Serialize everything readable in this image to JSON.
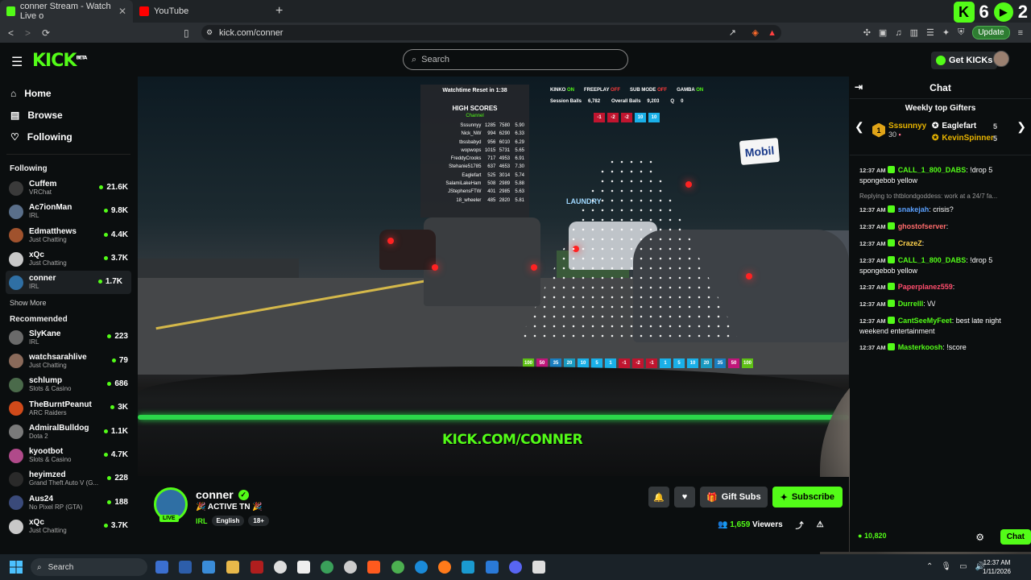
{
  "browser": {
    "tabs": [
      {
        "label": "conner Stream - Watch Live o",
        "active": true,
        "favicon_color": "#53fc18"
      },
      {
        "label": "YouTube",
        "active": false,
        "favicon_color": "#ff0000"
      }
    ],
    "new_tab_icon": "plus-icon",
    "top_right_score": {
      "kick": "6",
      "play": "2"
    },
    "url": "kick.com/conner",
    "update_label": "Update",
    "shield_badge": "1"
  },
  "header": {
    "logo": "KICK",
    "logo_sup": "BETA",
    "search_placeholder": "Search",
    "get_kicks_label": "Get KICKs"
  },
  "sidebar": {
    "nav": [
      {
        "label": "Home",
        "icon": "home-icon"
      },
      {
        "label": "Browse",
        "icon": "browse-icon"
      },
      {
        "label": "Following",
        "icon": "heart-icon"
      }
    ],
    "following_title": "Following",
    "following": [
      {
        "name": "Cuffem",
        "category": "VRChat",
        "viewers": "21.6K",
        "color": "#3a3a3a"
      },
      {
        "name": "Ac7ionMan",
        "category": "IRL",
        "viewers": "9.8K",
        "color": "#5a6f8a"
      },
      {
        "name": "Edmatthews",
        "category": "Just Chatting",
        "viewers": "4.4K",
        "color": "#a0522d"
      },
      {
        "name": "xQc",
        "category": "Just Chatting",
        "viewers": "3.7K",
        "color": "#c8c8c8"
      },
      {
        "name": "conner",
        "category": "IRL",
        "viewers": "1.7K",
        "color": "#2f6fa4"
      }
    ],
    "show_more": "Show More",
    "recommended_title": "Recommended",
    "recommended": [
      {
        "name": "SlyKane",
        "category": "IRL",
        "viewers": "223",
        "color": "#6a6a6a"
      },
      {
        "name": "watchsarahlive",
        "category": "Just Chatting",
        "viewers": "79",
        "color": "#8a6a5a"
      },
      {
        "name": "schlump",
        "category": "Slots & Casino",
        "viewers": "686",
        "color": "#4a6a4a"
      },
      {
        "name": "TheBurntPeanut",
        "category": "ARC Raiders",
        "viewers": "3K",
        "color": "#d04a1a"
      },
      {
        "name": "AdmiralBulldog",
        "category": "Dota 2",
        "viewers": "1.1K",
        "color": "#7a7a7a"
      },
      {
        "name": "kyootbot",
        "category": "Slots & Casino",
        "viewers": "4.7K",
        "color": "#b04a8a"
      },
      {
        "name": "heyimzed",
        "category": "Grand Theft Auto V (G...",
        "viewers": "228",
        "color": "#2a2a2a"
      },
      {
        "name": "Aus24",
        "category": "No Pixel RP (GTA)",
        "viewers": "188",
        "color": "#3a4a7a"
      },
      {
        "name": "xQc",
        "category": "Just Chatting",
        "viewers": "3.7K",
        "color": "#c8c8c8"
      }
    ]
  },
  "overlay": {
    "watchtime": "Watchtime Reset in 1:38",
    "high_scores_title": "HIGH SCORES",
    "high_scores_subtitle": "Channel",
    "high_scores": [
      [
        "Sssunnyy",
        "1285",
        "7580",
        "5.90"
      ],
      [
        "Nick_NW",
        "994",
        "6290",
        "6.33"
      ],
      [
        "tbssbabyd",
        "956",
        "6010",
        "6.29"
      ],
      [
        "wopwops",
        "1015",
        "5731",
        "5.65"
      ],
      [
        "FreddyCrooks",
        "717",
        "4953",
        "6.91"
      ],
      [
        "Stehanie51785",
        "637",
        "4653",
        "7.30"
      ],
      [
        "Eaglefart",
        "525",
        "3014",
        "5.74"
      ],
      [
        "SalamiLakeHam",
        "508",
        "2989",
        "5.88"
      ],
      [
        "JStephensFTW",
        "401",
        "2985",
        "5.63"
      ],
      [
        "18_wheeler",
        "485",
        "2820",
        "5.81"
      ]
    ],
    "modes": [
      {
        "label": "KINKO",
        "state": "ON",
        "state_color": "#53fc18"
      },
      {
        "label": "FREEPLAY",
        "state": "OFF",
        "state_color": "#ff3b3b"
      },
      {
        "label": "SUB MODE",
        "state": "OFF",
        "state_color": "#ff3b3b"
      },
      {
        "label": "GAMBA",
        "state": "ON",
        "state_color": "#53fc18"
      }
    ],
    "session_balls_label": "Session Balls",
    "session_balls": "6,782",
    "overall_balls_label": "Overall Balls",
    "overall_balls": "9,203",
    "queue_label": "Q",
    "queue": "0",
    "top_badges": [
      {
        "v": "-1",
        "c": "#c0152f"
      },
      {
        "v": "-2",
        "c": "#c0152f"
      },
      {
        "v": "-2",
        "c": "#c0152f"
      },
      {
        "v": "10",
        "c": "#1ab0e8"
      },
      {
        "v": "10",
        "c": "#1ab0e8"
      }
    ],
    "bottom_badges": [
      {
        "v": "100",
        "c": "#5ec016"
      },
      {
        "v": "50",
        "c": "#c0167a"
      },
      {
        "v": "35",
        "c": "#1a7ec0"
      },
      {
        "v": "20",
        "c": "#1a9ac0"
      },
      {
        "v": "10",
        "c": "#1ab0e8"
      },
      {
        "v": "5",
        "c": "#1ab0e8"
      },
      {
        "v": "1",
        "c": "#1ab0e8"
      },
      {
        "v": "-1",
        "c": "#c0152f"
      },
      {
        "v": "-2",
        "c": "#c0152f"
      },
      {
        "v": "-1",
        "c": "#c0152f"
      },
      {
        "v": "1",
        "c": "#1ab0e8"
      },
      {
        "v": "5",
        "c": "#1ab0e8"
      },
      {
        "v": "10",
        "c": "#1ab0e8"
      },
      {
        "v": "20",
        "c": "#1a9ac0"
      },
      {
        "v": "35",
        "c": "#1a7ec0"
      },
      {
        "v": "50",
        "c": "#c0167a"
      },
      {
        "v": "100",
        "c": "#5ec016"
      }
    ],
    "sign_text": "Mobil",
    "laundry_text": "LAUNDRY",
    "watermark": "KICK.COM/CONNER"
  },
  "stream": {
    "name": "conner",
    "title": "🎉 ACTIVE TN 🎉",
    "category": "IRL",
    "tags": [
      "English",
      "18+"
    ],
    "live_label": "LIVE",
    "gift_label": "Gift Subs",
    "subscribe_label": "Subscribe",
    "viewers": "1,659",
    "viewers_label": "Viewers"
  },
  "chat": {
    "title": "Chat",
    "gifters_title": "Weekly top Gifters",
    "top_gifter": {
      "name": "Sssunnyy",
      "count": "30",
      "rank": "1"
    },
    "gifters": [
      {
        "name": "Eaglefart",
        "count": "5",
        "color": "#ffffff"
      },
      {
        "name": "KevinSpinner",
        "count": "5",
        "color": "#e8b400"
      }
    ],
    "messages": [
      {
        "time": "12:37 AM",
        "user": "CALL_1_800_DABS",
        "color": "#53fc18",
        "text": "!drop 5 spongebob yellow"
      },
      {
        "reply": "Replying to thtblondgoddess: work at a 24/7 fa..."
      },
      {
        "time": "12:37 AM",
        "user": "snakejah",
        "color": "#5aa0ff",
        "text": "crisis?"
      },
      {
        "time": "12:37 AM",
        "user": "ghostofserver",
        "color": "#ff6b6b",
        "text": ""
      },
      {
        "time": "12:37 AM",
        "user": "CrazeZ",
        "color": "#ffd34d",
        "text": ""
      },
      {
        "time": "12:37 AM",
        "user": "CALL_1_800_DABS",
        "color": "#53fc18",
        "text": "!drop 5 spongebob yellow"
      },
      {
        "time": "12:37 AM",
        "user": "Paperplanez559",
        "color": "#ff4d6d",
        "text": ""
      },
      {
        "time": "12:37 AM",
        "user": "Durrelll",
        "color": "#53fc18",
        "text": "\\/\\/"
      },
      {
        "time": "12:37 AM",
        "user": "CantSeeMyFeet",
        "color": "#53fc18",
        "text": "best late night weekend entertainment"
      },
      {
        "time": "12:37 AM",
        "user": "Masterkoosh",
        "color": "#53fc18",
        "text": "!score"
      }
    ],
    "points": "10,820",
    "chat_button": "Chat"
  },
  "taskbar": {
    "search_placeholder": "Search",
    "time": "12:37 AM",
    "date": "1/11/2026"
  }
}
